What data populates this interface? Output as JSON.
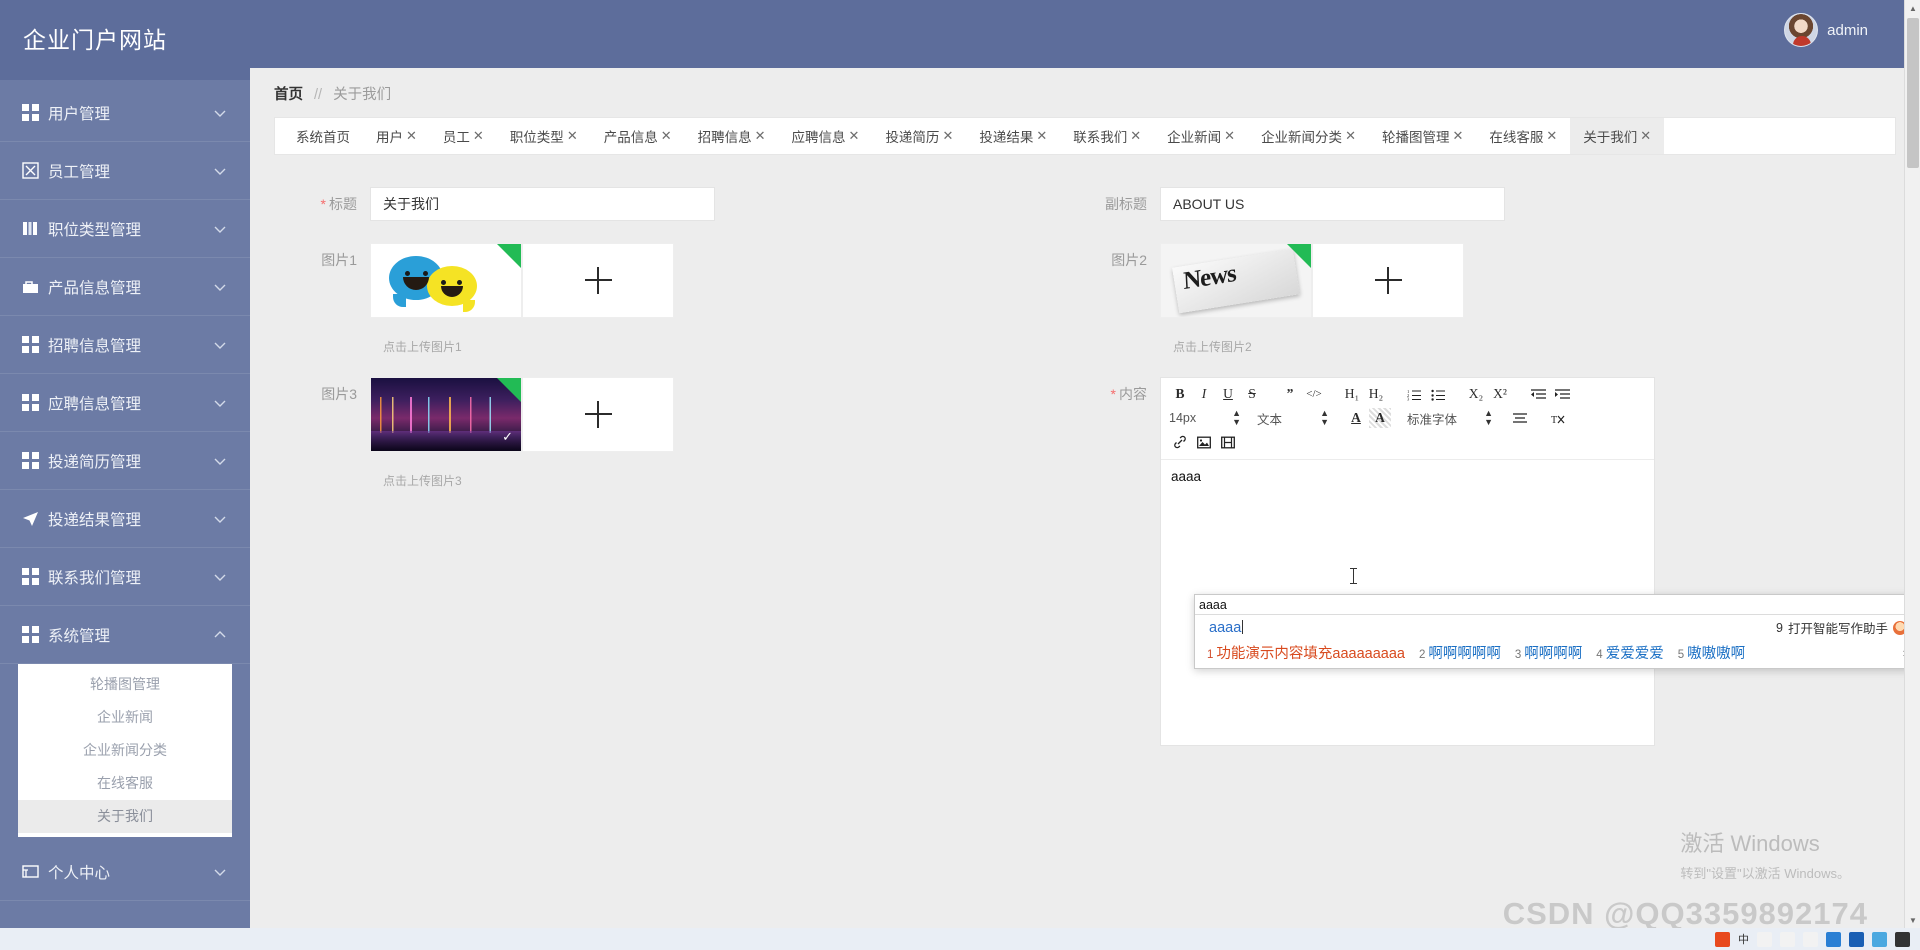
{
  "brand": "企业门户网站",
  "header": {
    "username": "admin",
    "avatar_icon": "user-avatar"
  },
  "sidebar": {
    "items": [
      {
        "label": "用户管理",
        "icon": "grid-icon",
        "arrow": "chevron-down-icon"
      },
      {
        "label": "员工管理",
        "icon": "employee-icon",
        "arrow": "chevron-down-icon"
      },
      {
        "label": "职位类型管理",
        "icon": "chart-icon",
        "arrow": "chevron-down-icon"
      },
      {
        "label": "产品信息管理",
        "icon": "product-icon",
        "arrow": "chevron-down-icon"
      },
      {
        "label": "招聘信息管理",
        "icon": "grid-icon",
        "arrow": "chevron-down-icon"
      },
      {
        "label": "应聘信息管理",
        "icon": "grid-icon",
        "arrow": "chevron-down-icon"
      },
      {
        "label": "投递简历管理",
        "icon": "grid-icon",
        "arrow": "chevron-down-icon"
      },
      {
        "label": "投递结果管理",
        "icon": "send-icon",
        "arrow": "chevron-down-icon"
      },
      {
        "label": "联系我们管理",
        "icon": "grid-icon",
        "arrow": "chevron-down-icon"
      },
      {
        "label": "系统管理",
        "icon": "grid-icon",
        "arrow": "chevron-up-icon"
      }
    ],
    "submenu": [
      {
        "label": "轮播图管理",
        "active": false
      },
      {
        "label": "企业新闻",
        "active": false
      },
      {
        "label": "企业新闻分类",
        "active": false
      },
      {
        "label": "在线客服",
        "active": false
      },
      {
        "label": "关于我们",
        "active": true
      }
    ],
    "bottom_item": {
      "label": "个人中心",
      "icon": "id-card-icon",
      "arrow": "chevron-down-icon"
    }
  },
  "breadcrumb": {
    "home": "首页",
    "separator": "//",
    "current": "关于我们"
  },
  "tabs": [
    {
      "label": "系统首页",
      "closable": false,
      "active": false
    },
    {
      "label": "用户",
      "closable": true,
      "active": false
    },
    {
      "label": "员工",
      "closable": true,
      "active": false
    },
    {
      "label": "职位类型",
      "closable": true,
      "active": false
    },
    {
      "label": "产品信息",
      "closable": true,
      "active": false
    },
    {
      "label": "招聘信息",
      "closable": true,
      "active": false
    },
    {
      "label": "应聘信息",
      "closable": true,
      "active": false
    },
    {
      "label": "投递简历",
      "closable": true,
      "active": false
    },
    {
      "label": "投递结果",
      "closable": true,
      "active": false
    },
    {
      "label": "联系我们",
      "closable": true,
      "active": false
    },
    {
      "label": "企业新闻",
      "closable": true,
      "active": false
    },
    {
      "label": "企业新闻分类",
      "closable": true,
      "active": false
    },
    {
      "label": "轮播图管理",
      "closable": true,
      "active": false
    },
    {
      "label": "在线客服",
      "closable": true,
      "active": false
    },
    {
      "label": "关于我们",
      "closable": true,
      "active": true
    }
  ],
  "form": {
    "title_label": "标题",
    "title_required": "*",
    "title_value": "关于我们",
    "subtitle_label": "副标题",
    "subtitle_value": "ABOUT US",
    "image1_label": "图片1",
    "image1_hint": "点击上传图片1",
    "image1_alt": "smiley-speech-bubbles-image",
    "image2_label": "图片2",
    "image2_hint": "点击上传图片2",
    "image2_alt": "news-newspaper-image",
    "image3_label": "图片3",
    "image3_hint": "点击上传图片3",
    "image3_alt": "night-city-skyline-image",
    "upload_plus": "+",
    "content_label": "内容",
    "content_required": "*"
  },
  "editor": {
    "buttons_row1": [
      "B",
      "I",
      "U",
      "S",
      "”",
      "</>",
      "H₁",
      "H₂"
    ],
    "list_ordered": "ordered-list-icon",
    "list_unordered": "unordered-list-icon",
    "subscript": "X₂",
    "superscript": "X²",
    "indent_decrease": "indent-decrease-icon",
    "indent_increase": "indent-increase-icon",
    "font_size": "14px",
    "text_style": "文本",
    "font_family": "标准字体",
    "text_color_icon": "text-color-icon",
    "highlight_icon": "highlight-icon",
    "align_icon": "align-icon",
    "clear_format_icon": "clear-format-icon",
    "link_icon": "link-icon",
    "image_icon": "image-icon",
    "video_icon": "video-icon",
    "body_text": "aaaa"
  },
  "ime": {
    "input_text": "aaaa",
    "composition": "aaaa",
    "assistant_number": "9",
    "assistant_label": "打开智能写作助手",
    "candidates": [
      {
        "num": "1",
        "text": "功能演示内容填充aaaaaaaaa"
      },
      {
        "num": "2",
        "text": "啊啊啊啊啊"
      },
      {
        "num": "3",
        "text": "啊啊啊啊"
      },
      {
        "num": "4",
        "text": "爱爱爱爱"
      },
      {
        "num": "5",
        "text": "嗷嗷嗷啊"
      }
    ],
    "next_page": "›"
  },
  "watermarks": {
    "windows_line1": "激活 Windows",
    "windows_line2": "转到\"设置\"以激活 Windows。",
    "csdn": "CSDN @QQ3359892174"
  },
  "taskbar": {
    "items": [
      "中",
      "♥",
      "⌨",
      "☰",
      "🔵",
      "📘",
      "🐦",
      "⬛"
    ]
  },
  "colors": {
    "sidebar_bg": "#6c7ba5",
    "header_bg": "#5d6d9b",
    "content_bg": "#ededed",
    "badge_green": "#22bb55",
    "required_red": "#f56c6c",
    "ime_first_candidate": "#d84a1e",
    "ime_candidate_blue": "#1a6fc4"
  }
}
